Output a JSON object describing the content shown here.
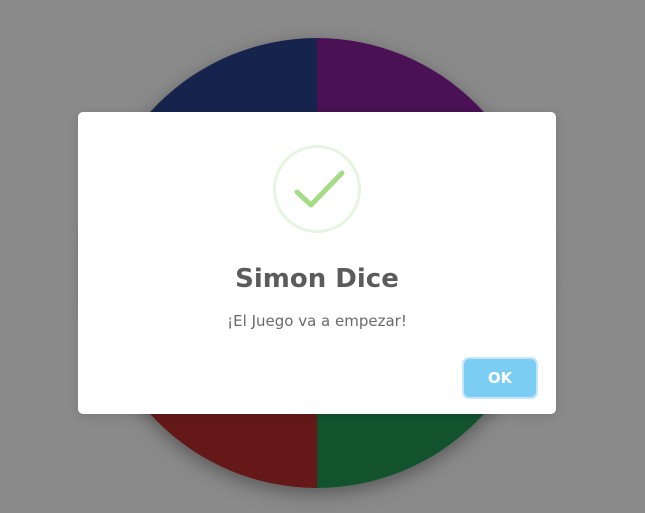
{
  "board": {
    "colors": {
      "top_left": "#16234d",
      "top_right": "#4a1155",
      "bottom_left": "#651818",
      "bottom_right": "#12532e"
    }
  },
  "dialog": {
    "icon": "success-checkmark-icon",
    "icon_color": "#a5dc86",
    "title": "Simon Dice",
    "message": "¡El Juego va a empezar!",
    "ok_label": "OK",
    "ok_color": "#7ccdf4"
  }
}
